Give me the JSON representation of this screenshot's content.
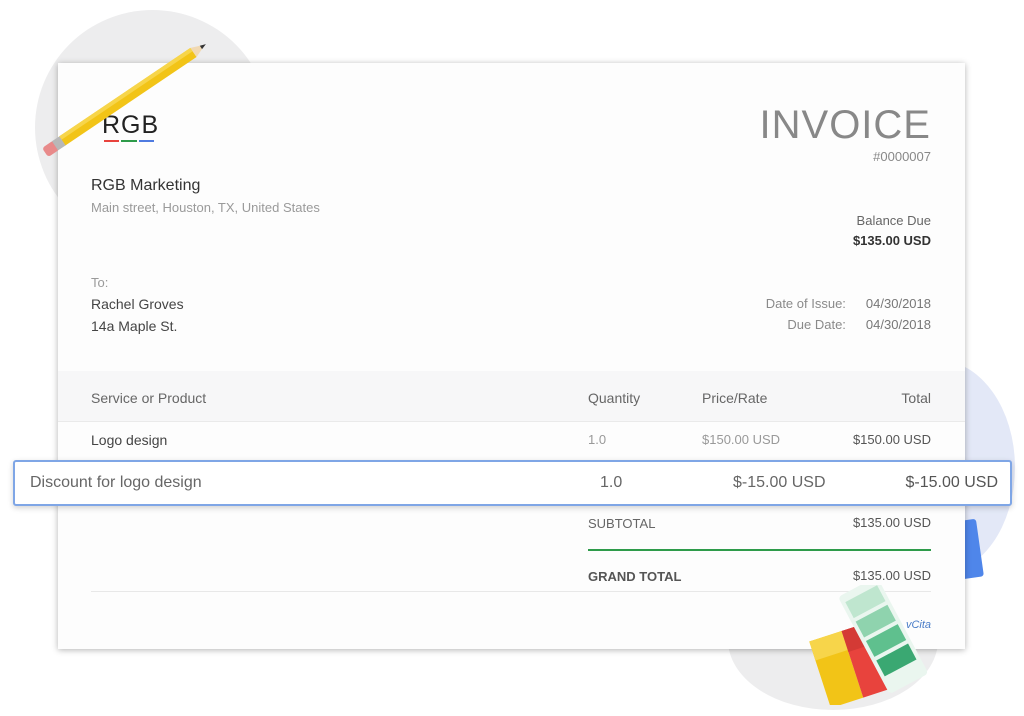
{
  "logo": {
    "text": "RGB",
    "bar_colors": [
      "#e8433d",
      "#2e9b4a",
      "#4f7be0"
    ]
  },
  "company": {
    "name": "RGB Marketing",
    "address": "Main street, Houston, TX, United States"
  },
  "invoice": {
    "title": "INVOICE",
    "number": "#0000007",
    "balance_label": "Balance Due",
    "balance_amount": "$135.00 USD"
  },
  "client": {
    "to_label": "To:",
    "name": "Rachel Groves",
    "address": "14a Maple St."
  },
  "dates": {
    "issue_label": "Date of Issue:",
    "issue_value": "04/30/2018",
    "due_label": "Due Date:",
    "due_value": "04/30/2018"
  },
  "table": {
    "headers": {
      "service": "Service or Product",
      "quantity": "Quantity",
      "price": "Price/Rate",
      "total": "Total"
    },
    "rows": [
      {
        "service": "Logo design",
        "quantity": "1.0",
        "price": "$150.00 USD",
        "total": "$150.00 USD"
      },
      {
        "service": "Discount for logo design",
        "quantity": "1.0",
        "price": "$-15.00 USD",
        "total": "$-15.00 USD"
      }
    ]
  },
  "totals": {
    "subtotal_label": "SUBTOTAL",
    "subtotal_value": "$135.00 USD",
    "grand_label": "GRAND TOTAL",
    "grand_value": "$135.00 USD"
  },
  "footer": {
    "powered_by": "vCita"
  },
  "colors": {
    "accent_green": "#2e9b4a",
    "highlight_border": "#7fa6e6",
    "link_blue": "#4a7dc8"
  },
  "icons": {
    "pencil": "pencil-icon",
    "swatches": "color-swatches-icon"
  }
}
